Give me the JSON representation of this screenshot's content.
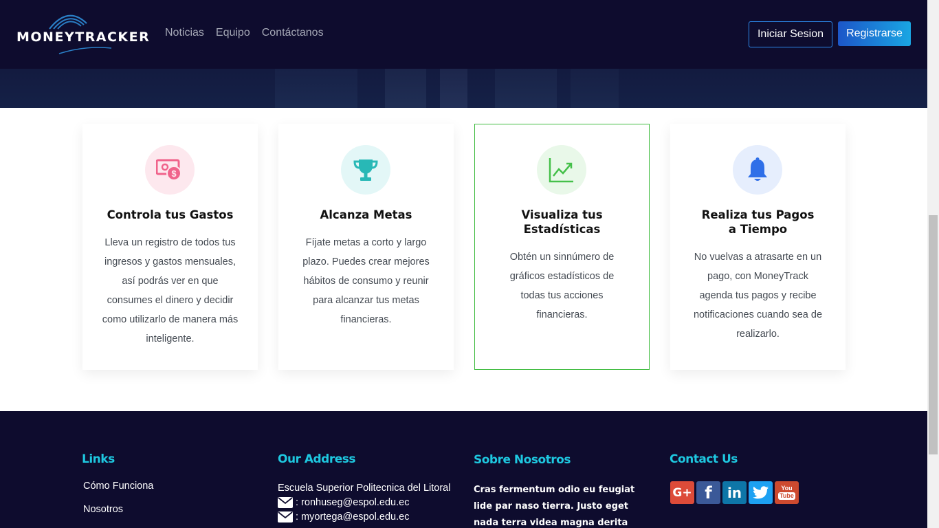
{
  "header": {
    "logo_text": "MONEYTRACKER",
    "nav": [
      {
        "label": "Noticias"
      },
      {
        "label": "Equipo"
      },
      {
        "label": "Contáctanos"
      }
    ],
    "login_label": "Iniciar Sesion",
    "register_label": "Registrarse"
  },
  "features": [
    {
      "icon": "money-icon",
      "icon_bg": "#fde8ee",
      "icon_color": "#f0638b",
      "title": "Controla tus Gastos",
      "text": "Lleva un registro de todos tus ingresos y gastos mensuales, así podrás ver en que consumes el dinero y decidir como utilizarlo de manera más inteligente."
    },
    {
      "icon": "trophy-icon",
      "icon_bg": "#e3f7f7",
      "icon_color": "#28b8b6",
      "title": "Alcanza Metas",
      "text": "Fíjate metas a corto y largo plazo. Puedes crear mejores hábitos de consumo y reunir para alcanzar tus metas financieras."
    },
    {
      "icon": "chart-line-icon",
      "icon_bg": "#e9f8e9",
      "icon_color": "#45c04a",
      "title": "Visualiza tus Estadísticas",
      "text": "Obtén un sinnúmero de gráficos estadísticos de todas tus acciones financieras."
    },
    {
      "icon": "bell-icon",
      "icon_bg": "#e6eefd",
      "icon_color": "#2f6fe8",
      "title": "Realiza tus Pagos a Tiempo",
      "text": "No vuelvas a atrasarte en un pago, con MoneyTrack agenda tus pagos y recibe notificaciones cuando sea de realizarlo."
    }
  ],
  "footer": {
    "links": {
      "heading": "Links",
      "items": [
        {
          "label": "Cómo Funciona"
        },
        {
          "label": "Nosotros"
        }
      ]
    },
    "address": {
      "heading": "Our Address",
      "institution": "Escuela Superior Politecnica del Litoral",
      "emails": [
        ": ronhuseg@espol.edu.ec",
        ": myortega@espol.edu.ec"
      ]
    },
    "about": {
      "heading": "Sobre Nosotros",
      "text": "Cras fermentum odio eu feugiat lide par naso tierra. Justo eget nada terra videa magna derita valies darta donna mare"
    },
    "contact": {
      "heading": "Contact Us",
      "socials": [
        {
          "name": "google-plus-icon",
          "color": "#dd4b39"
        },
        {
          "name": "facebook-icon",
          "color": "#3b5998"
        },
        {
          "name": "linkedin-icon",
          "color": "#0e76a8"
        },
        {
          "name": "twitter-icon",
          "color": "#1da1f2"
        },
        {
          "name": "youtube-icon",
          "color": "#cd4a2f"
        }
      ]
    }
  }
}
